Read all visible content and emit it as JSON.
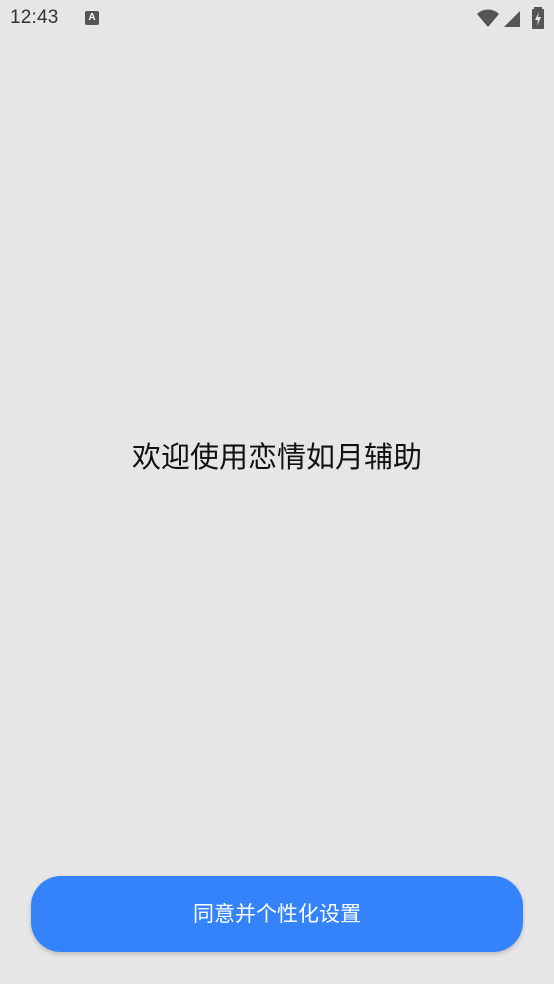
{
  "status_bar": {
    "time": "12:43",
    "notification_icon": "a-notification-icon",
    "wifi_icon": "wifi-icon",
    "signal_icon": "cellular-signal-icon",
    "battery_icon": "battery-charging-icon",
    "notification_letter": "A"
  },
  "main": {
    "welcome_text": "欢迎使用恋情如月辅助"
  },
  "footer": {
    "agree_button_label": "同意并个性化设置"
  },
  "colors": {
    "background": "#e6e6e6",
    "button": "#3483fb",
    "button_text": "#ffffff"
  }
}
